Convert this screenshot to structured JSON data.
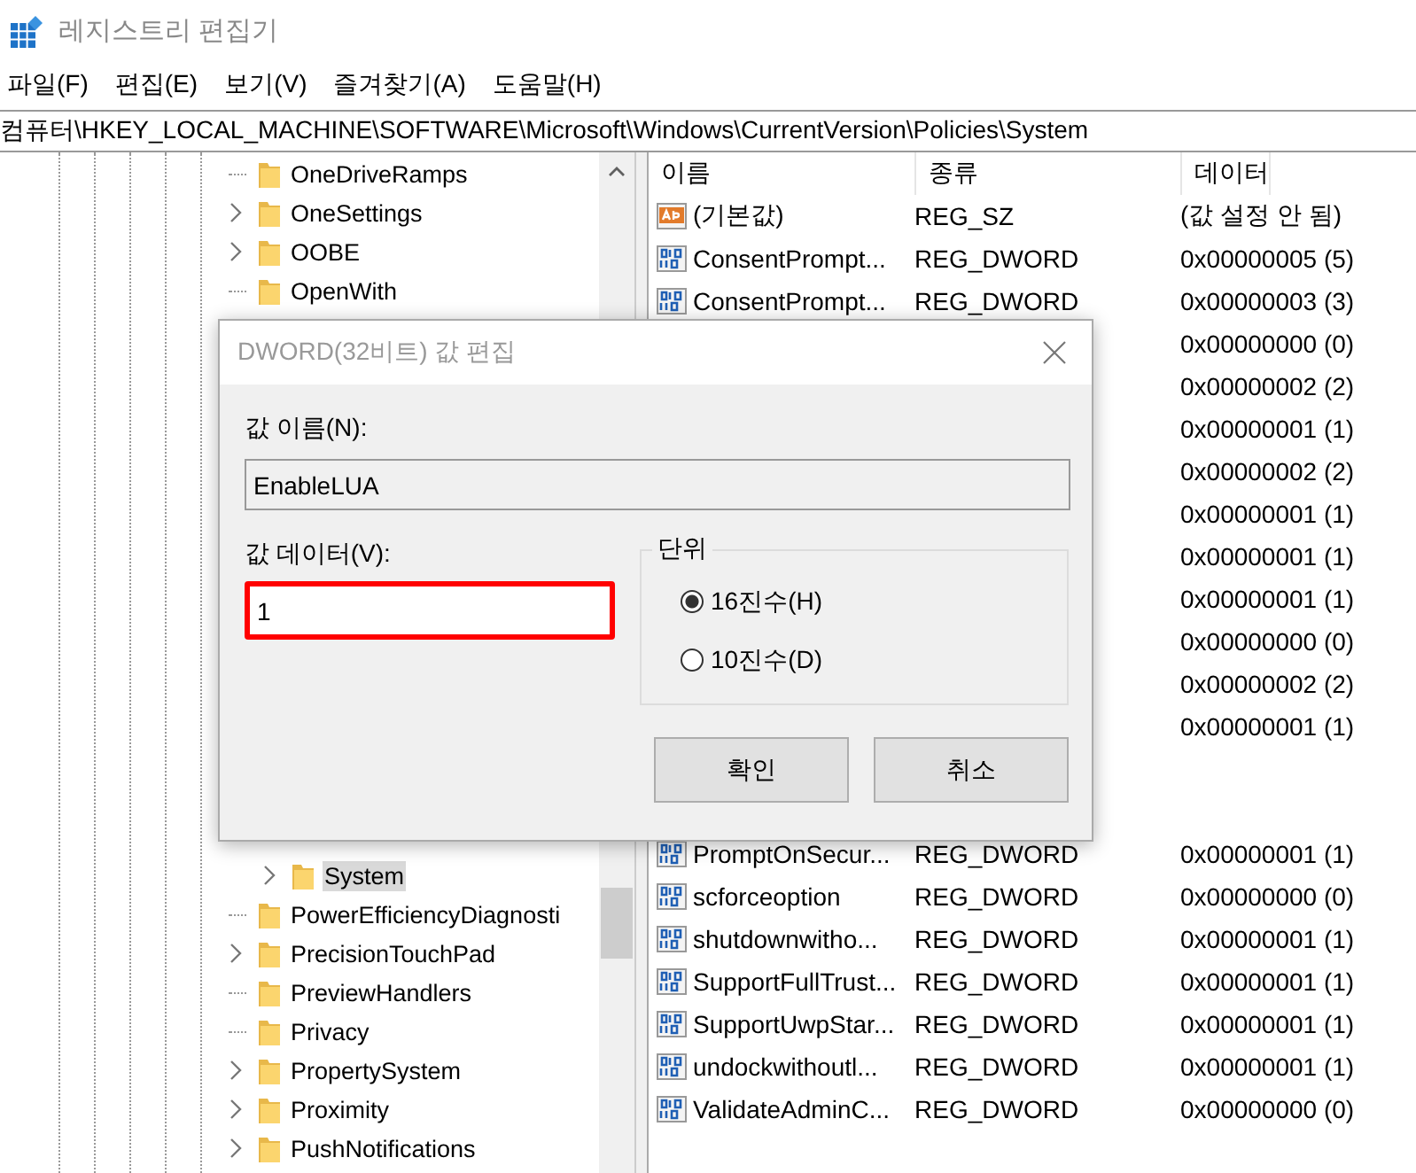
{
  "window": {
    "title": "레지스트리 편집기"
  },
  "menu": [
    "파일(F)",
    "편집(E)",
    "보기(V)",
    "즐겨찾기(A)",
    "도움말(H)"
  ],
  "address": "컴퓨터\\HKEY_LOCAL_MACHINE\\SOFTWARE\\Microsoft\\Windows\\CurrentVersion\\Policies\\System",
  "tree": {
    "upper": [
      {
        "label": "OneDriveRamps",
        "expandable": false,
        "selected": false
      },
      {
        "label": "OneSettings",
        "expandable": true,
        "selected": false
      },
      {
        "label": "OOBE",
        "expandable": true,
        "selected": false
      },
      {
        "label": "OpenWith",
        "expandable": false,
        "selected": false
      }
    ],
    "nested": [
      {
        "label": "System",
        "expandable": true,
        "selected": true
      }
    ],
    "lower": [
      {
        "label": "PowerEfficiencyDiagnosti",
        "expandable": false,
        "selected": false
      },
      {
        "label": "PrecisionTouchPad",
        "expandable": true,
        "selected": false
      },
      {
        "label": "PreviewHandlers",
        "expandable": false,
        "selected": false
      },
      {
        "label": "Privacy",
        "expandable": false,
        "selected": false
      },
      {
        "label": "PropertySystem",
        "expandable": true,
        "selected": false
      },
      {
        "label": "Proximity",
        "expandable": true,
        "selected": false
      },
      {
        "label": "PushNotifications",
        "expandable": true,
        "selected": false
      }
    ]
  },
  "list": {
    "columns": [
      "이름",
      "종류",
      "데이터"
    ],
    "rows_top": [
      {
        "kind": "sz",
        "name": "(기본값)",
        "type": "REG_SZ",
        "data": "(값 설정 안 됨)"
      },
      {
        "kind": "dword",
        "name": "ConsentPrompt...",
        "type": "REG_DWORD",
        "data": "0x00000005 (5)"
      },
      {
        "kind": "dword",
        "name": "ConsentPrompt...",
        "type": "REG_DWORD",
        "data": "0x00000003 (3)"
      },
      {
        "data": "0x00000000 (0)"
      },
      {
        "data": "0x00000002 (2)"
      },
      {
        "data": "0x00000001 (1)"
      },
      {
        "data": "0x00000002 (2)"
      },
      {
        "data": "0x00000001 (1)"
      },
      {
        "data": "0x00000001 (1)"
      },
      {
        "data": "0x00000001 (1)"
      },
      {
        "data": "0x00000000 (0)"
      },
      {
        "data": "0x00000002 (2)"
      },
      {
        "data": "0x00000001 (1)"
      }
    ],
    "rows_bottom": [
      {
        "kind": "dword",
        "name": "PromptOnSecur...",
        "type": "REG_DWORD",
        "data": "0x00000001 (1)"
      },
      {
        "kind": "dword",
        "name": "scforceoption",
        "type": "REG_DWORD",
        "data": "0x00000000 (0)"
      },
      {
        "kind": "dword",
        "name": "shutdownwitho...",
        "type": "REG_DWORD",
        "data": "0x00000001 (1)"
      },
      {
        "kind": "dword",
        "name": "SupportFullTrust...",
        "type": "REG_DWORD",
        "data": "0x00000001 (1)"
      },
      {
        "kind": "dword",
        "name": "SupportUwpStar...",
        "type": "REG_DWORD",
        "data": "0x00000001 (1)"
      },
      {
        "kind": "dword",
        "name": "undockwithoutl...",
        "type": "REG_DWORD",
        "data": "0x00000001 (1)"
      },
      {
        "kind": "dword",
        "name": "ValidateAdminC...",
        "type": "REG_DWORD",
        "data": "0x00000000 (0)"
      }
    ]
  },
  "dialog": {
    "title": "DWORD(32비트) 값 편집",
    "name_label": "값 이름(N):",
    "name_value": "EnableLUA",
    "data_label": "값 데이터(V):",
    "data_value": "1",
    "data_highlighted": true,
    "base_group": "단위",
    "bases": [
      {
        "label": "16진수(H)",
        "selected": true
      },
      {
        "label": "10진수(D)",
        "selected": false
      }
    ],
    "buttons": [
      "확인",
      "취소"
    ]
  }
}
